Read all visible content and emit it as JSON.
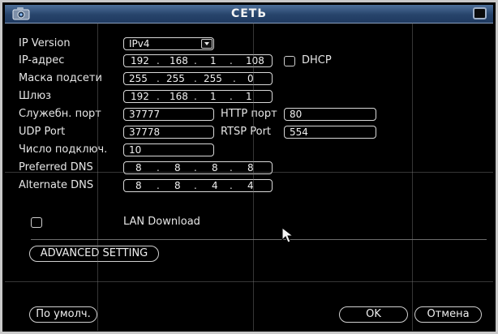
{
  "window": {
    "title": "СЕТЬ",
    "app_icon": "camera-icon",
    "close_icon": "close-icon"
  },
  "form": {
    "ip_version": {
      "label": "IP Version",
      "value": "IPv4"
    },
    "ip_address": {
      "label": "IP-адрес",
      "octets": [
        "192",
        "168",
        "1",
        "108"
      ]
    },
    "dhcp": {
      "label": "DHCP",
      "checked": false
    },
    "subnet_mask": {
      "label": "Маска подсети",
      "octets": [
        "255",
        "255",
        "255",
        "0"
      ]
    },
    "gateway": {
      "label": "Шлюз",
      "octets": [
        "192",
        "168",
        "1",
        "1"
      ]
    },
    "service_port": {
      "label": "Служебн. порт",
      "value": "37777"
    },
    "http_port": {
      "label": "HTTP порт",
      "value": "80"
    },
    "udp_port": {
      "label": "UDP Port",
      "value": "37778"
    },
    "rtsp_port": {
      "label": "RTSP Port",
      "value": "554"
    },
    "max_connections": {
      "label": "Число подключ.",
      "value": "10"
    },
    "preferred_dns": {
      "label": "Preferred DNS",
      "octets": [
        "8",
        "8",
        "8",
        "8"
      ]
    },
    "alternate_dns": {
      "label": "Alternate DNS",
      "octets": [
        "8",
        "8",
        "4",
        "4"
      ]
    },
    "lan_download": {
      "label": "LAN Download",
      "checked": false
    }
  },
  "buttons": {
    "advanced": "ADVANCED SETTING",
    "default": "По умолч.",
    "ok": "OK",
    "cancel": "Отмена"
  },
  "colors": {
    "title_bar": "#27446b",
    "background": "#000000",
    "field_border": "#d8d8d8"
  }
}
